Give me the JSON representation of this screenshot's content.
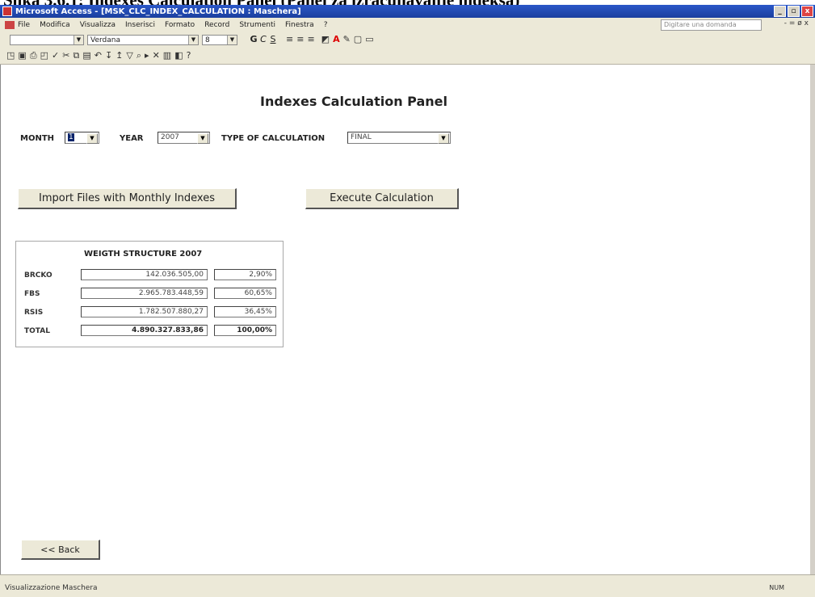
{
  "caption": "Slika 3.6.1: Indexes Calculation Panel (Panel za izračunavanje indeksa)",
  "window": {
    "title": "Microsoft Access - [MSK_CLC_INDEX_CALCULATION : Maschera]",
    "minimize": "_",
    "restore": "▫",
    "close": "x"
  },
  "menu": {
    "items": [
      "File",
      "Modifica",
      "Visualizza",
      "Inserisci",
      "Formato",
      "Record",
      "Strumenti",
      "Finestra",
      "?"
    ],
    "help_placeholder": "Digitare una domanda",
    "window_controls": "- = ø x"
  },
  "toolbar1": {
    "object_combo": "",
    "font_combo": "Verdana",
    "size_combo": "8",
    "bold": "G",
    "italic": "C",
    "underline": "S"
  },
  "panel": {
    "title": "Indexes Calculation Panel",
    "month_label": "MONTH",
    "month_value": "1",
    "year_label": "YEAR",
    "year_value": "2007",
    "calc_type_label": "TYPE OF CALCULATION",
    "calc_type_value": "FINAL",
    "import_button": "Import Files with Monthly Indexes",
    "execute_button": "Execute Calculation",
    "back_button": "<< Back"
  },
  "weight_structure": {
    "title": "WEIGTH STRUCTURE 2007",
    "rows": [
      {
        "label": "BRCKO",
        "value": "142.036.505,00",
        "pct": "2,90%"
      },
      {
        "label": "FBS",
        "value": "2.965.783.448,59",
        "pct": "60,65%"
      },
      {
        "label": "RSIS",
        "value": "1.782.507.880,27",
        "pct": "36,45%"
      }
    ],
    "total": {
      "label": "TOTAL",
      "value": "4.890.327.833,86",
      "pct": "100,00%"
    }
  },
  "status": {
    "left": "Visualizzazione Maschera",
    "right": "NUM"
  },
  "colors": {
    "titlebar": "#2a57c8",
    "chrome": "#ece9d8"
  }
}
